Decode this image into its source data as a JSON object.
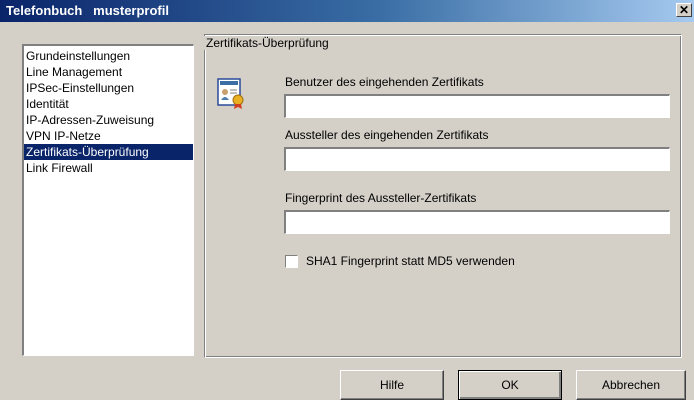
{
  "window": {
    "title": "Telefonbuch   musterprofil",
    "close_symbol": "✕"
  },
  "nav": {
    "items": [
      "Grundeinstellungen",
      "Line Management",
      "IPSec-Einstellungen",
      "Identität",
      "IP-Adressen-Zuweisung",
      "VPN IP-Netze",
      "Zertifikats-Überprüfung",
      "Link Firewall"
    ],
    "selected": "Zertifikats-Überprüfung"
  },
  "panel": {
    "title": "Zertifikats-Überprüfung",
    "icon": "certificate-icon",
    "fields": {
      "user_label": "Benutzer des eingehenden Zertifikats",
      "user_value": "",
      "issuer_label": "Aussteller des eingehenden Zertifikats",
      "issuer_value": "",
      "fingerprint_label": "Fingerprint des Aussteller-Zertifikats",
      "fingerprint_value": ""
    },
    "sha1_checkbox": {
      "label": "SHA1 Fingerprint statt MD5 verwenden",
      "checked": false
    }
  },
  "buttons": {
    "help": "Hilfe",
    "ok": "OK",
    "cancel": "Abbrechen"
  },
  "colors": {
    "titlebar": "#0a246a",
    "selection": "#0a246a",
    "face": "#d4d0c8"
  }
}
